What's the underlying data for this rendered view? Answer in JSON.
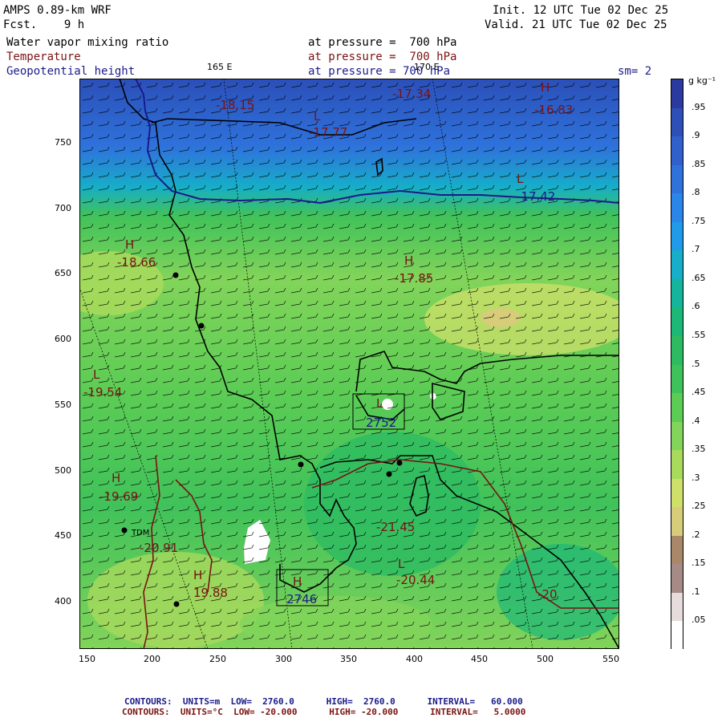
{
  "header": {
    "model": "AMPS 0.89-km WRF",
    "fcst_label": "Fcst.",
    "fcst_value": "9 h",
    "init": "Init. 12 UTC Tue 02 Dec 25",
    "valid": "Valid. 21 UTC Tue 02 Dec 25",
    "fields": [
      {
        "name": "Water vapor mixing ratio",
        "level": "at pressure =  700 hPa"
      },
      {
        "name": "Temperature",
        "level": "at pressure =  700 hPa"
      },
      {
        "name": "Geopotential height",
        "level": "at pressure = 700 hPa"
      }
    ],
    "lon_label_1": "165 E",
    "lon_label_2": "170 E",
    "smoothing": "sm= 2"
  },
  "axes": {
    "x_ticks": [
      "150",
      "200",
      "250",
      "300",
      "350",
      "400",
      "450",
      "500",
      "550"
    ],
    "y_ticks": [
      "750",
      "700",
      "650",
      "600",
      "550",
      "500",
      "450",
      "400"
    ]
  },
  "colorbar": {
    "units": "g kg⁻¹",
    "labels": [
      ".95",
      ".9",
      ".85",
      ".8",
      ".75",
      ".7",
      ".65",
      ".6",
      ".55",
      ".5",
      ".45",
      ".4",
      ".35",
      ".3",
      ".25",
      ".2",
      ".15",
      ".1",
      ".05"
    ],
    "colors": [
      "#2b3a9e",
      "#2f4fb8",
      "#3060cc",
      "#2f72dc",
      "#2a86e8",
      "#1f9bea",
      "#16aec8",
      "#14b59c",
      "#1cb878",
      "#2dbb62",
      "#40c25a",
      "#5ccc55",
      "#82d45a",
      "#a8da5c",
      "#cfe06a",
      "#d6cc7a",
      "#a9886a",
      "#a68a86",
      "#e6dcdc",
      "#ffffff"
    ]
  },
  "map_labels": [
    {
      "text": "-18.15",
      "color": "red"
    },
    {
      "text": "L",
      "color": "red"
    },
    {
      "text": "-17.77",
      "color": "red"
    },
    {
      "text": "-17.34",
      "color": "red"
    },
    {
      "text": "H",
      "color": "red"
    },
    {
      "text": "-16.83",
      "color": "red"
    },
    {
      "text": "L",
      "color": "red"
    },
    {
      "text": "-17.42",
      "color": "blue"
    },
    {
      "text": "H",
      "color": "red"
    },
    {
      "text": "-18.66",
      "color": "red"
    },
    {
      "text": "H",
      "color": "red"
    },
    {
      "text": "-17.85",
      "color": "red"
    },
    {
      "text": "L",
      "color": "red"
    },
    {
      "text": "-19.54",
      "color": "red"
    },
    {
      "text": "L",
      "color": "red"
    },
    {
      "text": "2752",
      "color": "blue"
    },
    {
      "text": "H",
      "color": "red"
    },
    {
      "text": "-19.69",
      "color": "red"
    },
    {
      "text": "TDM",
      "color": "black"
    },
    {
      "text": "-20.91",
      "color": "red"
    },
    {
      "text": "-21.45",
      "color": "red"
    },
    {
      "text": "H",
      "color": "red"
    },
    {
      "text": "19.88",
      "color": "red"
    },
    {
      "text": "H",
      "color": "red"
    },
    {
      "text": "2746",
      "color": "blue"
    },
    {
      "text": "L",
      "color": "red"
    },
    {
      "text": "-20.44",
      "color": "red"
    },
    {
      "text": "-20",
      "color": "red"
    }
  ],
  "footer": {
    "line1": "CONTOURS:  UNITS=m  LOW=  2760.0      HIGH=  2760.0      INTERVAL=   60.000",
    "line2": "CONTOURS:  UNITS=°C  LOW= -20.000      HIGH= -20.000      INTERVAL=   5.0000"
  }
}
